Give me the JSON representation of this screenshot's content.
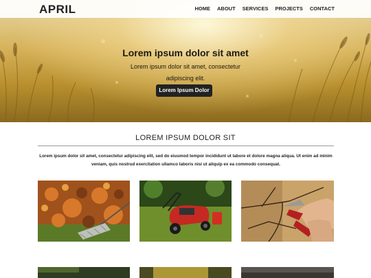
{
  "header": {
    "logo": "APRIL",
    "nav": [
      "HOME",
      "ABOUT",
      "SERVICES",
      "PROJECTS",
      "CONTACT"
    ]
  },
  "hero": {
    "title": "Lorem ipsum dolor sit amet",
    "subtitle": "Lorem ipsum dolor sit amet, consectetur adipiscing elit.",
    "button_label": "Lorem Ipsum Dolor"
  },
  "section": {
    "title": "LOREM IPSUM DOLOR SIT",
    "text": "Lorem ipsum dolor sit amet, consectetur adipiscing elit, sed do eiusmod tempor incididunt ut labore et dolore magna aliqua. Ut enim ad minim veniam, quis nostrud exercitation ullamco laboris nisi ut aliquip ex ea commodo consequat."
  },
  "gallery": {
    "items": [
      "raking-autumn-leaves",
      "lawn-mower",
      "pruning-branch"
    ],
    "more_row": [
      "garden-photo",
      "garden-photo",
      "garden-photo"
    ]
  }
}
